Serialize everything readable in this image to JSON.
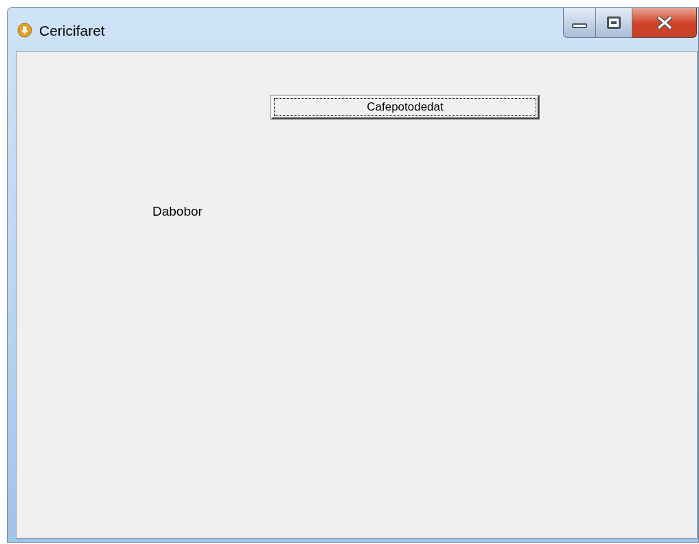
{
  "window": {
    "title": "Cericifaret"
  },
  "button": {
    "label": "Cafepotodedat",
    "focused": true
  },
  "label": {
    "text": "Dabobor"
  }
}
